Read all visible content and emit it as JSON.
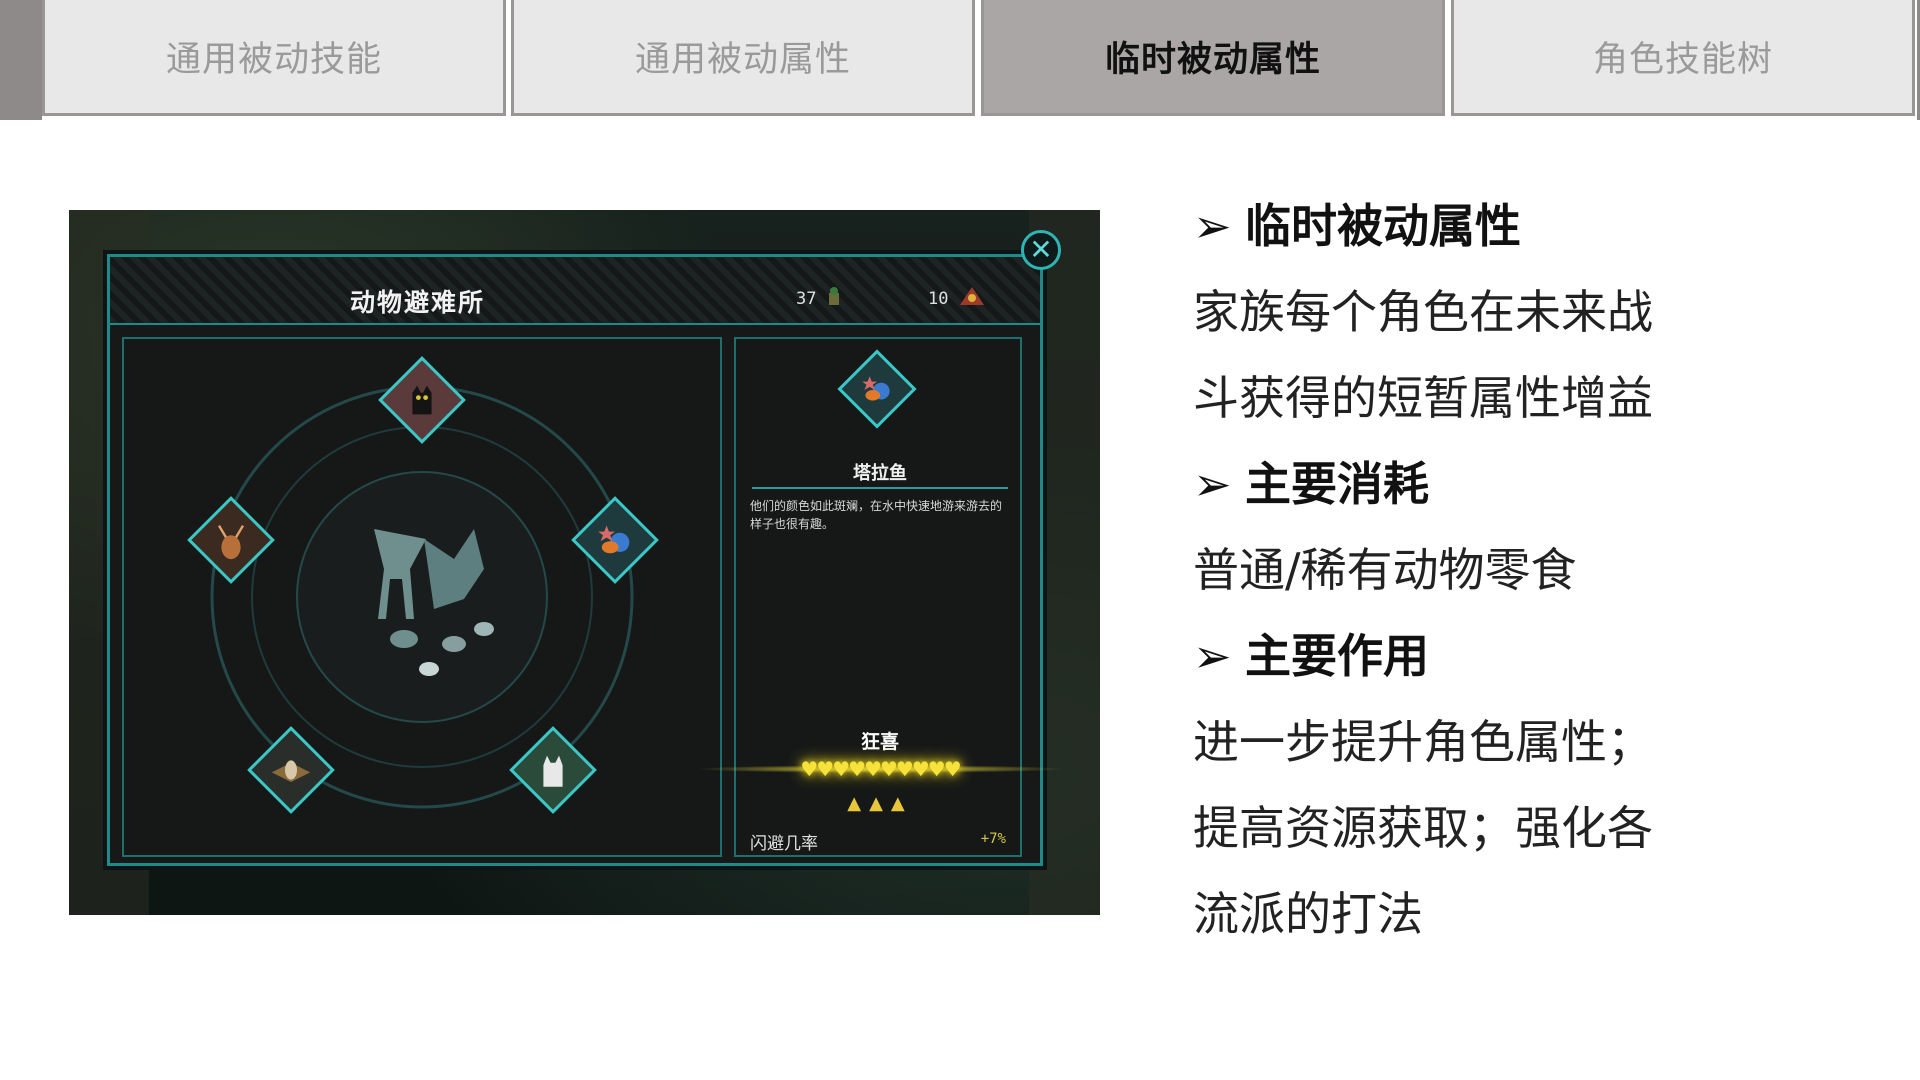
{
  "tabs": [
    {
      "label": "通用被动技能",
      "active": false
    },
    {
      "label": "通用被动属性",
      "active": false
    },
    {
      "label": "临时被动属性",
      "active": true
    },
    {
      "label": "角色技能树",
      "active": false
    }
  ],
  "game": {
    "title": "动物避难所",
    "counter_a": "37",
    "counter_b": "10",
    "close_symbol": "✕",
    "fish_name": "塔拉鱼",
    "fish_desc": "他们的颜色如此斑斓，在水中快速地游来游去的样子也很有趣。",
    "mood_label": "狂喜",
    "hearts": "♥♥♥♥♥♥♥♥♥♥",
    "stars": "▲▲▲",
    "stat_name": "闪避几率",
    "stat_value": "+7%",
    "slots": [
      "cat-icon",
      "deer-icon",
      "fish-icon",
      "owl-icon",
      "wolf-icon"
    ],
    "colors": {
      "frame": "#1f8a8a",
      "accent": "#3cc7c7",
      "heart": "#f5e23a"
    }
  },
  "notes": {
    "heading1": "临时被动属性",
    "line1": "家族每个角色在未来战",
    "line2": "斗获得的短暂属性增益",
    "heading2": "主要消耗",
    "line3": "普通/稀有动物零食",
    "heading3": "主要作用",
    "line4": "进一步提升角色属性；",
    "line5": "提高资源获取；强化各",
    "line6": "流派的打法",
    "bullet_symbol": "➢"
  }
}
